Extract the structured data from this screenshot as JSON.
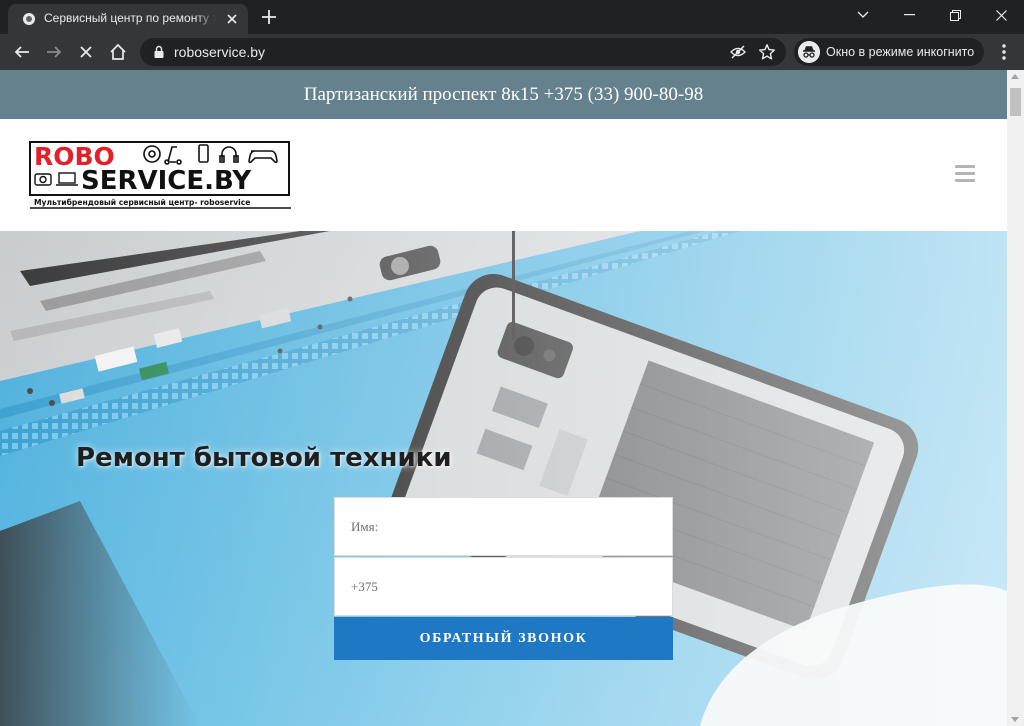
{
  "browser": {
    "tab_title": "Сервисный центр по ремонту техники",
    "url": "roboservice.by",
    "incognito_label": "Окно в режиме инкогнито"
  },
  "page": {
    "topbar_text": "Партизанский проспект 8к15 +375 (33) 900-80-98",
    "logo": {
      "line1": "ROBO",
      "line2": "SERVICE.BY",
      "tagline": "Мультибрендовый сервисный центр- roboservice"
    },
    "hero": {
      "title": "Ремонт бытовой техники"
    },
    "form": {
      "name_placeholder": "Имя:",
      "phone_placeholder": "+375",
      "submit_label": "ОБРАТНЫЙ ЗВОНОК"
    }
  },
  "colors": {
    "topbar": "#65818e",
    "button": "#1f78c4",
    "mat": "#5bb6df"
  },
  "icons": [
    "search-icon",
    "back-icon",
    "forward-icon",
    "stop-icon",
    "home-icon",
    "lock-icon",
    "eye-off-icon",
    "star-icon",
    "incognito-icon",
    "menu-icon",
    "hamburger-icon"
  ]
}
